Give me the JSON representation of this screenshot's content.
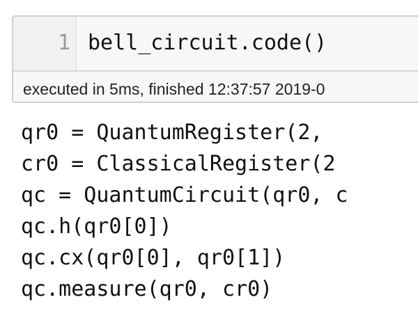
{
  "cell": {
    "line_number": "1",
    "input_code": "bell_circuit.code()",
    "execution_info": "executed in 5ms, finished 12:37:57 2019-0"
  },
  "output": {
    "lines": [
      "qr0 = QuantumRegister(2,",
      "cr0 = ClassicalRegister(2",
      "qc = QuantumCircuit(qr0, c",
      "qc.h(qr0[0])",
      "qc.cx(qr0[0], qr0[1])",
      "qc.measure(qr0, cr0)"
    ]
  }
}
